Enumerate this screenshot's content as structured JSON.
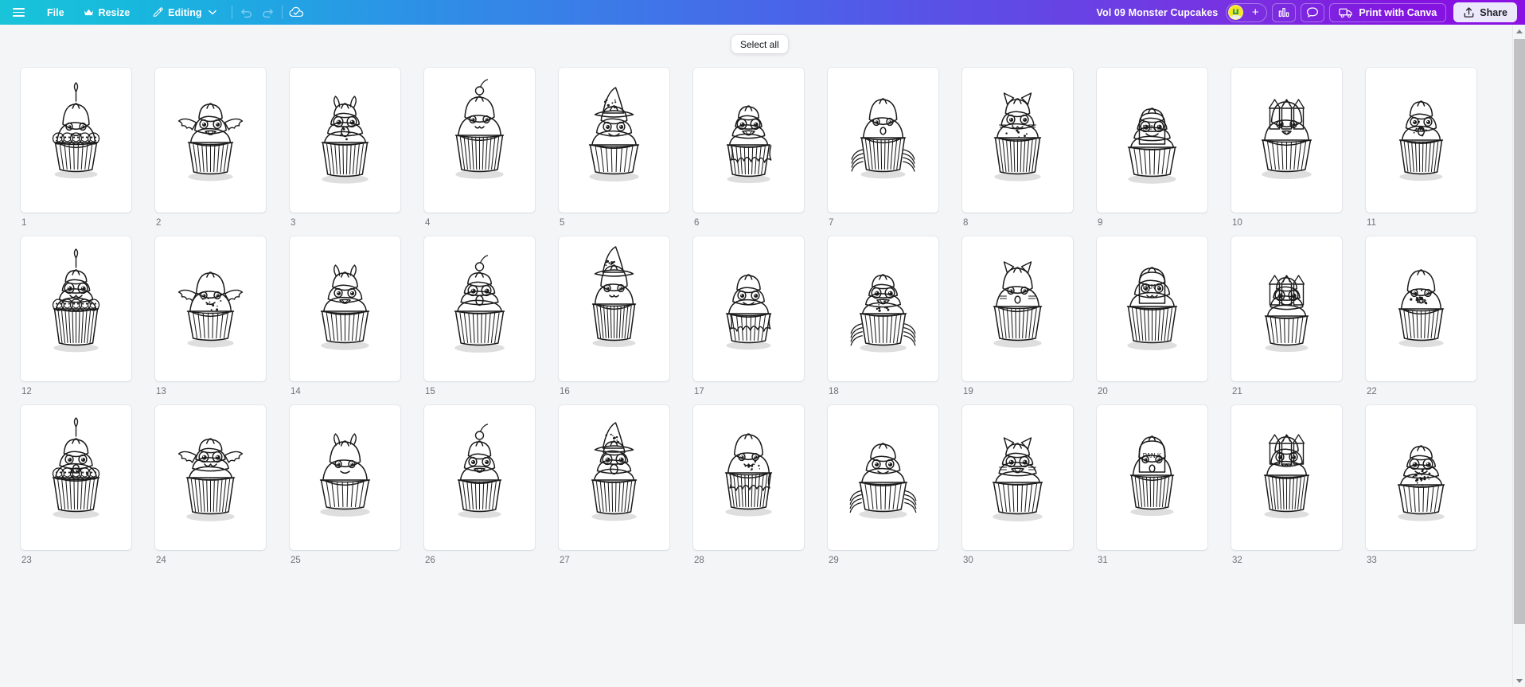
{
  "toolbar": {
    "menu_icon": "hamburger-icon",
    "file_label": "File",
    "resize_label": "Resize",
    "resize_icon": "crown-icon",
    "editing_label": "Editing",
    "editing_icon": "pencil-icon",
    "editing_chevron": "chevron-down-icon",
    "undo_icon": "undo-icon",
    "redo_icon": "redo-icon",
    "cloud_icon": "cloud-check-icon",
    "doc_title": "Vol 09 Monster Cupcakes",
    "avatar_icon": "user-avatar",
    "add_collaborator_label": "+",
    "insights_icon": "bar-chart-icon",
    "comments_icon": "comment-bubble-icon",
    "print_icon": "delivery-truck-icon",
    "print_label": "Print with Canva",
    "share_icon": "share-upload-icon",
    "share_label": "Share",
    "gradient_start": "#19c4d9",
    "gradient_mid": "#4a63e8",
    "gradient_end": "#8b10e3"
  },
  "overlay": {
    "select_all_label": "Select all"
  },
  "scrollbar": {
    "up_icon": "scroll-up-arrow",
    "down_icon": "scroll-down-arrow",
    "thumb": "scrollbar-thumb"
  },
  "grid": {
    "columns": 11,
    "pages": [
      {
        "num": "1",
        "art": "cupcake-five-monster-faces-candle"
      },
      {
        "num": "2",
        "art": "cupcake-goofy-monster-swirl-sprinkles"
      },
      {
        "num": "3",
        "art": "cupcake-tall-swirl-smiley"
      },
      {
        "num": "4",
        "art": "cupcake-cherry-top-happy-face"
      },
      {
        "num": "5",
        "art": "cupcake-pirate-hat-eyepatch"
      },
      {
        "num": "6",
        "art": "cupcake-ghost-swirl-cute"
      },
      {
        "num": "7",
        "art": "cupcake-spider-legs-monster"
      },
      {
        "num": "8",
        "art": "cupcake-cat-ears-whiskers"
      },
      {
        "num": "9",
        "art": "cupcake-horned-devil-swirl"
      },
      {
        "num": "10",
        "art": "cupcake-angry-curly-hair-monster"
      },
      {
        "num": "11",
        "art": "cupcake-winged-dragon-horns"
      },
      {
        "num": "12",
        "art": "cupcake-one-eye-flame-swirl"
      },
      {
        "num": "13",
        "art": "cupcake-unicorn-horn-monster"
      },
      {
        "num": "14",
        "art": "cupcake-haunted-castle-towers"
      },
      {
        "num": "15",
        "art": "cupcake-witch-hat-broom"
      },
      {
        "num": "16",
        "art": "cupcake-big-eyes-drippy-legs"
      },
      {
        "num": "17",
        "art": "cupcake-bat-wings-small"
      },
      {
        "num": "18",
        "art": "cupcake-screaming-mouth-horns"
      },
      {
        "num": "19",
        "art": "cupcake-cyclops-dark-liner"
      },
      {
        "num": "20",
        "art": "cupcake-bunny-ears-sleepy-eyes"
      },
      {
        "num": "21",
        "art": "cupcake-large-bat-wings"
      },
      {
        "num": "22",
        "art": "cupcake-howling-wolf-moon"
      },
      {
        "num": "23",
        "art": "cupcake-tombstone-grave"
      },
      {
        "num": "24",
        "art": "cupcake-eyeball-swirl-topping"
      },
      {
        "num": "25",
        "art": "cupcake-brain-topping-wrap"
      },
      {
        "num": "26",
        "art": "cupcake-huge-eyes-drip-frosting"
      },
      {
        "num": "27",
        "art": "cupcake-bat-wings-smile-small"
      },
      {
        "num": "28",
        "art": "cupcake-melting-zombie-pile"
      },
      {
        "num": "29",
        "art": "cupcake-tall-drip-swirl-dots"
      },
      {
        "num": "30",
        "art": "cupcake-ghost-blob-happy"
      },
      {
        "num": "31",
        "art": "cupcake-spiky-sprinkle-top"
      },
      {
        "num": "32",
        "art": "cupcake-winking-monster-fangs"
      },
      {
        "num": "33",
        "art": "cupcake-wolf-head-ears"
      }
    ]
  }
}
